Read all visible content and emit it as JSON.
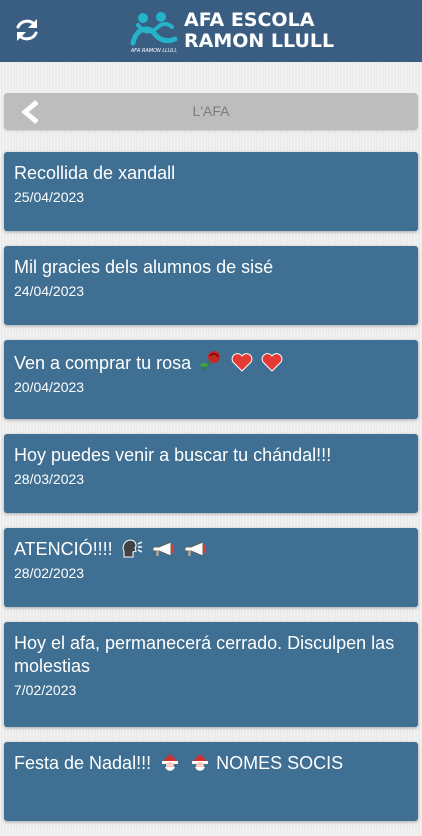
{
  "header": {
    "brand_line1": "AFA ESCOLA",
    "brand_line2": "RAMON LLULL",
    "logo_caption": "AFA RAMON LLULL",
    "refresh_icon": "refresh-icon",
    "background_color": "#3a5d82"
  },
  "nav": {
    "title": "L'AFA",
    "back_icon": "chevron-left-icon"
  },
  "news": [
    {
      "title": "Recollida de xandall",
      "date": "25/04/2023"
    },
    {
      "title": "Mil gracies dels alumnos de sisé",
      "date": "24/04/2023"
    },
    {
      "title": "Ven a comprar tu rosa",
      "emojis": [
        "rose-icon",
        "heart-icon",
        "heart-icon"
      ],
      "date": "20/04/2023"
    },
    {
      "title": "Hoy puedes venir a buscar tu chándal!!!",
      "date": "28/03/2023"
    },
    {
      "title": "ATENCIÓ!!!!",
      "emojis": [
        "speaking-head-icon",
        "megaphone-icon",
        "megaphone-icon"
      ],
      "date": "28/02/2023"
    },
    {
      "title": "Hoy el afa, permanecerá cerrado. Disculpen las molestias",
      "date": "7/02/2023"
    },
    {
      "title": "Festa de Nadal!!!",
      "emojis": [
        "santa-icon",
        "santa-icon"
      ],
      "title_suffix": "NOMES SOCIS",
      "date": ""
    }
  ],
  "colors": {
    "card": "#3f6f92",
    "back_bar": "#bdbdbd",
    "page_bg": "#ececec"
  }
}
